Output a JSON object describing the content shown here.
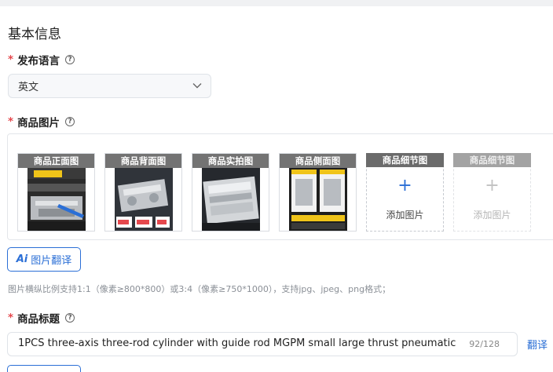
{
  "section_title": "基本信息",
  "language": {
    "required_mark": "*",
    "label": "发布语言",
    "help_glyph": "?",
    "value": "英文"
  },
  "images": {
    "required_mark": "*",
    "label": "商品图片",
    "help_glyph": "?",
    "cards": [
      {
        "caption": "商品正面图"
      },
      {
        "caption": "商品背面图"
      },
      {
        "caption": "商品实拍图"
      },
      {
        "caption": "商品侧面图"
      }
    ],
    "add_cards": [
      {
        "caption": "商品细节图",
        "plus": "+",
        "text": "添加图片",
        "enabled": true
      },
      {
        "caption": "商品细节图",
        "plus": "+",
        "text": "添加图片",
        "enabled": false
      }
    ],
    "translate_ai": "Ai",
    "translate_label": "图片翻译",
    "hint": "图片横纵比例支持1:1（像素≥800*800）或3:4（像素≥750*1000），支持jpg、jpeg、png格式；"
  },
  "product_title": {
    "required_mark": "*",
    "label": "商品标题",
    "help_glyph": "?",
    "value": "1PCS three-axis three-rod cylinder with guide rod MGPM small large thrust pneumatic",
    "count": "92/128",
    "translate_label": "翻译"
  },
  "colors": {
    "accent": "#2b6fd6",
    "required": "#e5484d"
  }
}
